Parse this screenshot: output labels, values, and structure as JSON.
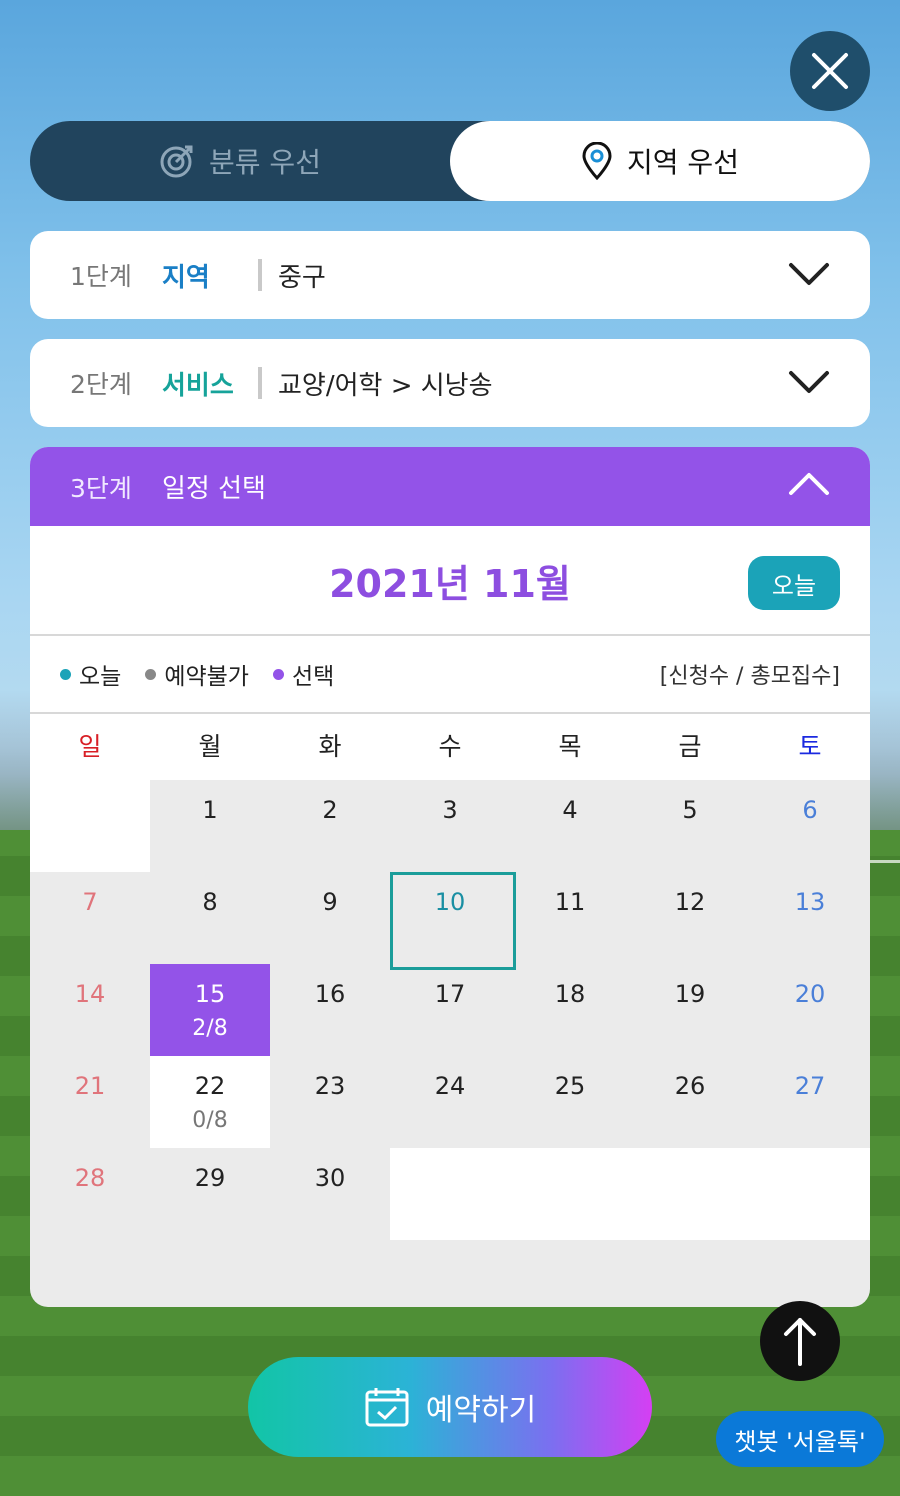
{
  "mode_toggle": {
    "category_label": "분류 우선",
    "region_label": "지역 우선",
    "active": "region"
  },
  "step1": {
    "num": "1단계",
    "key": "지역",
    "value": "중구",
    "key_color": "#1a7fc6"
  },
  "step2": {
    "num": "2단계",
    "key": "서비스",
    "value": "교양/어학 > 시낭송",
    "key_color": "#16a39a"
  },
  "step3": {
    "num": "3단계",
    "title": "일정 선택"
  },
  "calendar": {
    "month_title": "2021년 11월",
    "today_button": "오늘",
    "legend": {
      "today": "오늘",
      "unavailable": "예약불가",
      "selected": "선택",
      "note": "[신청수 / 총모집수]",
      "colors": {
        "today": "#1ba3b8",
        "unavailable": "#888888",
        "selected": "#9353e8"
      }
    },
    "weekdays": [
      "일",
      "월",
      "화",
      "수",
      "목",
      "금",
      "토"
    ],
    "weekday_colors": {
      "sun": "#d81f26",
      "sat": "#1b2ae0"
    },
    "days": [
      {
        "d": "",
        "type": "blank"
      },
      {
        "d": "1"
      },
      {
        "d": "2"
      },
      {
        "d": "3"
      },
      {
        "d": "4"
      },
      {
        "d": "5"
      },
      {
        "d": "6",
        "type": "sat"
      },
      {
        "d": "7",
        "type": "sun"
      },
      {
        "d": "8"
      },
      {
        "d": "9"
      },
      {
        "d": "10",
        "type": "today"
      },
      {
        "d": "11"
      },
      {
        "d": "12"
      },
      {
        "d": "13",
        "type": "sat"
      },
      {
        "d": "14",
        "type": "sun"
      },
      {
        "d": "15",
        "type": "selected",
        "sub": "2/8"
      },
      {
        "d": "16"
      },
      {
        "d": "17"
      },
      {
        "d": "18"
      },
      {
        "d": "19"
      },
      {
        "d": "20",
        "type": "sat"
      },
      {
        "d": "21",
        "type": "sun"
      },
      {
        "d": "22",
        "type": "avail",
        "sub": "0/8"
      },
      {
        "d": "23"
      },
      {
        "d": "24"
      },
      {
        "d": "25"
      },
      {
        "d": "26"
      },
      {
        "d": "27",
        "type": "sat"
      },
      {
        "d": "28",
        "type": "sun"
      },
      {
        "d": "29"
      },
      {
        "d": "30"
      },
      {
        "d": "",
        "type": "blank"
      },
      {
        "d": "",
        "type": "blank"
      },
      {
        "d": "",
        "type": "blank"
      },
      {
        "d": "",
        "type": "blank"
      }
    ]
  },
  "reserve_button": "예약하기",
  "chatbot_label": "챗봇 '서울톡'",
  "icons": {
    "close": "close-icon",
    "target": "target-icon",
    "location": "location-pin-icon",
    "chevron_down": "chevron-down-icon",
    "chevron_up": "chevron-up-icon",
    "calendar": "calendar-check-icon",
    "arrow_up": "arrow-up-icon"
  }
}
